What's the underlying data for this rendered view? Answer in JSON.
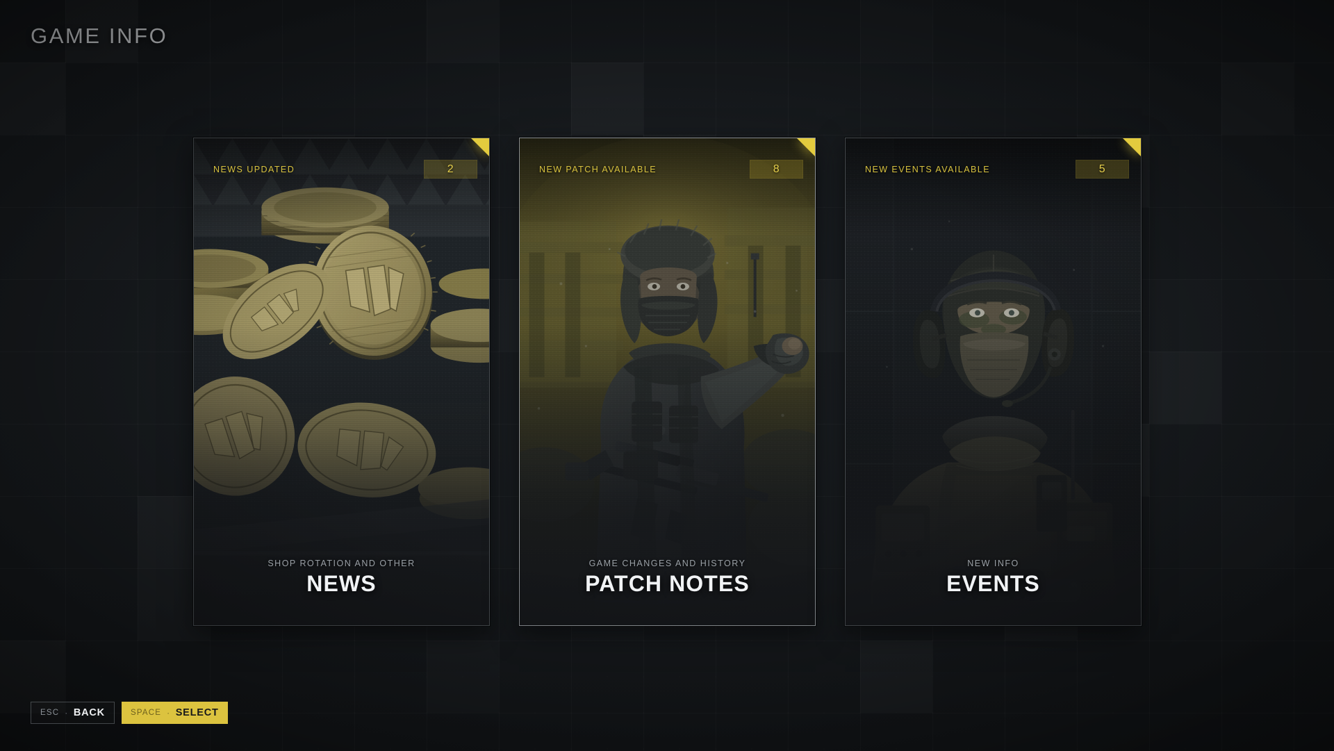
{
  "header": {
    "title": "GAME INFO"
  },
  "accent": {
    "gold": "#dcc33f",
    "gold_text": "#d8c23f",
    "title": "#f1f3f5",
    "sub": "#9aa0a6"
  },
  "cards": [
    {
      "id": "news",
      "badge_label": "NEWS UPDATED",
      "badge_count": "2",
      "subtitle": "SHOP ROTATION AND OTHER",
      "title": "NEWS",
      "art": "gold-coins-pile",
      "selected": false
    },
    {
      "id": "patch-notes",
      "badge_label": "NEW PATCH AVAILABLE",
      "badge_count": "8",
      "subtitle": "GAME CHANGES AND HISTORY",
      "title": "PATCH NOTES",
      "art": "soldier-ushanka-pointing",
      "selected": true
    },
    {
      "id": "events",
      "badge_label": "NEW EVENTS AVAILABLE",
      "badge_count": "5",
      "subtitle": "NEW INFO",
      "title": "EVENTS",
      "art": "soldier-headset-portrait",
      "selected": false
    }
  ],
  "hints": [
    {
      "key": "ESC",
      "sep": "·",
      "action": "BACK",
      "style": "ghost"
    },
    {
      "key": "SPACE",
      "sep": "·",
      "action": "SELECT",
      "style": "solid"
    }
  ]
}
